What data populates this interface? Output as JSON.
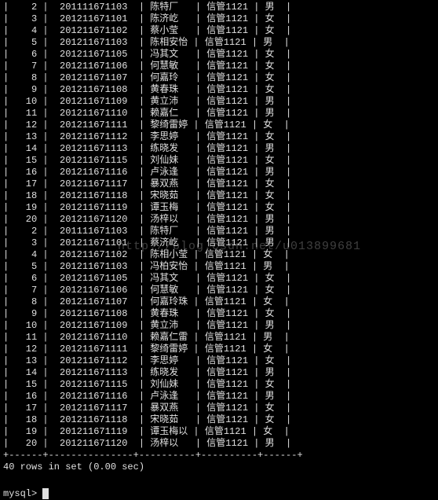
{
  "rows": [
    {
      "n": "2",
      "id": "201111671103",
      "name": "陈特厂",
      "cls": "信管1121",
      "sex": "男"
    },
    {
      "n": "3",
      "id": "201211671101",
      "name": "陈济屹",
      "cls": "信管1121",
      "sex": "女"
    },
    {
      "n": "4",
      "id": "201211671102",
      "name": "蔡小莹",
      "cls": "信管1121",
      "sex": "女"
    },
    {
      "n": "5",
      "id": "201211671103",
      "name": "陈相安怡",
      "cls": "信管1121",
      "sex": "男"
    },
    {
      "n": "6",
      "id": "201211671105",
      "name": "冯其文",
      "cls": "信管1121",
      "sex": "女"
    },
    {
      "n": "7",
      "id": "201211671106",
      "name": "何慧敏",
      "cls": "信管1121",
      "sex": "女"
    },
    {
      "n": "8",
      "id": "201211671107",
      "name": "何嘉玲",
      "cls": "信管1121",
      "sex": "女"
    },
    {
      "n": "9",
      "id": "201211671108",
      "name": "黄春珠",
      "cls": "信管1121",
      "sex": "女"
    },
    {
      "n": "10",
      "id": "201211671109",
      "name": "黄立沛",
      "cls": "信管1121",
      "sex": "男"
    },
    {
      "n": "11",
      "id": "201211671110",
      "name": "赖嘉仁",
      "cls": "信管1121",
      "sex": "男"
    },
    {
      "n": "12",
      "id": "201211671111",
      "name": "黎绮雷婷",
      "cls": "信管1121",
      "sex": "女"
    },
    {
      "n": "13",
      "id": "201211671112",
      "name": "李思婷",
      "cls": "信管1121",
      "sex": "女"
    },
    {
      "n": "14",
      "id": "201211671113",
      "name": "练晓发",
      "cls": "信管1121",
      "sex": "男"
    },
    {
      "n": "15",
      "id": "201211671115",
      "name": "刘仙妹",
      "cls": "信管1121",
      "sex": "女"
    },
    {
      "n": "16",
      "id": "201211671116",
      "name": "卢泳逢",
      "cls": "信管1121",
      "sex": "男"
    },
    {
      "n": "17",
      "id": "201211671117",
      "name": "暴双燕",
      "cls": "信管1121",
      "sex": "女"
    },
    {
      "n": "18",
      "id": "201211671118",
      "name": "宋晓茹",
      "cls": "信管1121",
      "sex": "女"
    },
    {
      "n": "19",
      "id": "201211671119",
      "name": "谭玉梅",
      "cls": "信管1121",
      "sex": "女"
    },
    {
      "n": "20",
      "id": "201211671120",
      "name": "汤梓以",
      "cls": "信管1121",
      "sex": "男"
    },
    {
      "n": "2",
      "id": "201111671103",
      "name": "陈特厂",
      "cls": "信管1121",
      "sex": "男"
    },
    {
      "n": "3",
      "id": "201211671101",
      "name": "蔡济屹",
      "cls": "信管1121",
      "sex": "男"
    },
    {
      "n": "4",
      "id": "201211671102",
      "name": "陈相小莹",
      "cls": "信管1121",
      "sex": "女"
    },
    {
      "n": "5",
      "id": "201211671103",
      "name": "冯柏安怡",
      "cls": "信管1121",
      "sex": "男"
    },
    {
      "n": "6",
      "id": "201211671105",
      "name": "冯其文",
      "cls": "信管1121",
      "sex": "女"
    },
    {
      "n": "7",
      "id": "201211671106",
      "name": "何慧敏",
      "cls": "信管1121",
      "sex": "女"
    },
    {
      "n": "8",
      "id": "201211671107",
      "name": "何嘉玲珠",
      "cls": "信管1121",
      "sex": "女"
    },
    {
      "n": "9",
      "id": "201211671108",
      "name": "黄春珠",
      "cls": "信管1121",
      "sex": "女"
    },
    {
      "n": "10",
      "id": "201211671109",
      "name": "黄立沛",
      "cls": "信管1121",
      "sex": "男"
    },
    {
      "n": "11",
      "id": "201211671110",
      "name": "赖嘉仁雷",
      "cls": "信管1121",
      "sex": "男"
    },
    {
      "n": "12",
      "id": "201211671111",
      "name": "黎绮雷婷",
      "cls": "信管1121",
      "sex": "女"
    },
    {
      "n": "13",
      "id": "201211671112",
      "name": "李思婷",
      "cls": "信管1121",
      "sex": "女"
    },
    {
      "n": "14",
      "id": "201211671113",
      "name": "练晓发",
      "cls": "信管1121",
      "sex": "男"
    },
    {
      "n": "15",
      "id": "201211671115",
      "name": "刘仙妹",
      "cls": "信管1121",
      "sex": "女"
    },
    {
      "n": "16",
      "id": "201211671116",
      "name": "卢泳逢",
      "cls": "信管1121",
      "sex": "男"
    },
    {
      "n": "17",
      "id": "201211671117",
      "name": "暴双燕",
      "cls": "信管1121",
      "sex": "女"
    },
    {
      "n": "18",
      "id": "201211671118",
      "name": "宋晓茹",
      "cls": "信管1121",
      "sex": "女"
    },
    {
      "n": "19",
      "id": "201211671119",
      "name": "谭玉梅以",
      "cls": "信管1121",
      "sex": "女"
    },
    {
      "n": "20",
      "id": "201211671120",
      "name": "汤梓以",
      "cls": "信管1121",
      "sex": "男"
    }
  ],
  "separator": "+------+---------------+----------+----------+------+",
  "footer": "40 rows in set (0.00 sec)",
  "prompt": "mysql>",
  "watermark": "http://blog.csdn.net/u013899681"
}
